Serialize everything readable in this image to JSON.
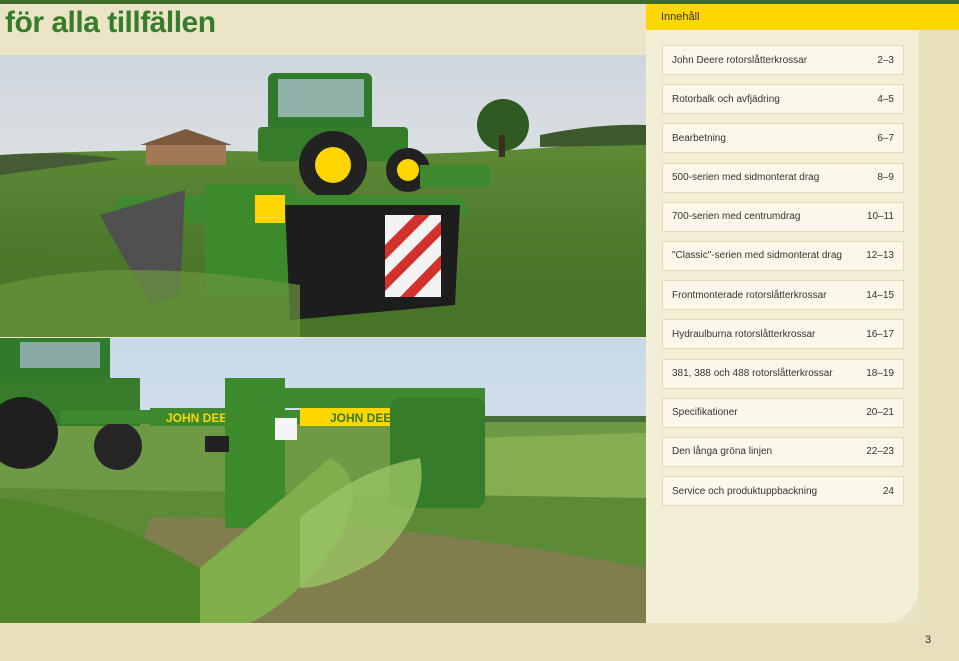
{
  "title": "för alla tillfällen",
  "toc": {
    "header": "Innehåll",
    "items": [
      {
        "label": "John Deere rotorslåtterkrossar",
        "pages": "2–3"
      },
      {
        "label": "Rotorbalk och avfjädring",
        "pages": "4–5"
      },
      {
        "label": "Bearbetning",
        "pages": "6–7"
      },
      {
        "label": "500-serien med sidmonterat drag",
        "pages": "8–9"
      },
      {
        "label": "700-serien med centrumdrag",
        "pages": "10–11"
      },
      {
        "label": "\"Classic\"-serien med sidmonterat drag",
        "pages": "12–13"
      },
      {
        "label": "Frontmonterade rotorslåtterkrossar",
        "pages": "14–15"
      },
      {
        "label": "Hydraulburna rotorslåtterkrossar",
        "pages": "16–17"
      },
      {
        "label": "381, 388 och 488 rotorslåtterkrossar",
        "pages": "18–19"
      },
      {
        "label": "Specifikationer",
        "pages": "20–21"
      },
      {
        "label": "Den långa gröna linjen",
        "pages": "22–23"
      },
      {
        "label": "Service och produktuppbackning",
        "pages": "24"
      }
    ]
  },
  "photos": {
    "top_brand": "",
    "bottom_brand_1": "JOHN DEERE",
    "bottom_brand_2": "JOHN DEERE"
  },
  "page_number": "3",
  "colors": {
    "brand_green": "#367c2b",
    "brand_yellow": "#ffd600",
    "panel": "#f3eed6"
  }
}
